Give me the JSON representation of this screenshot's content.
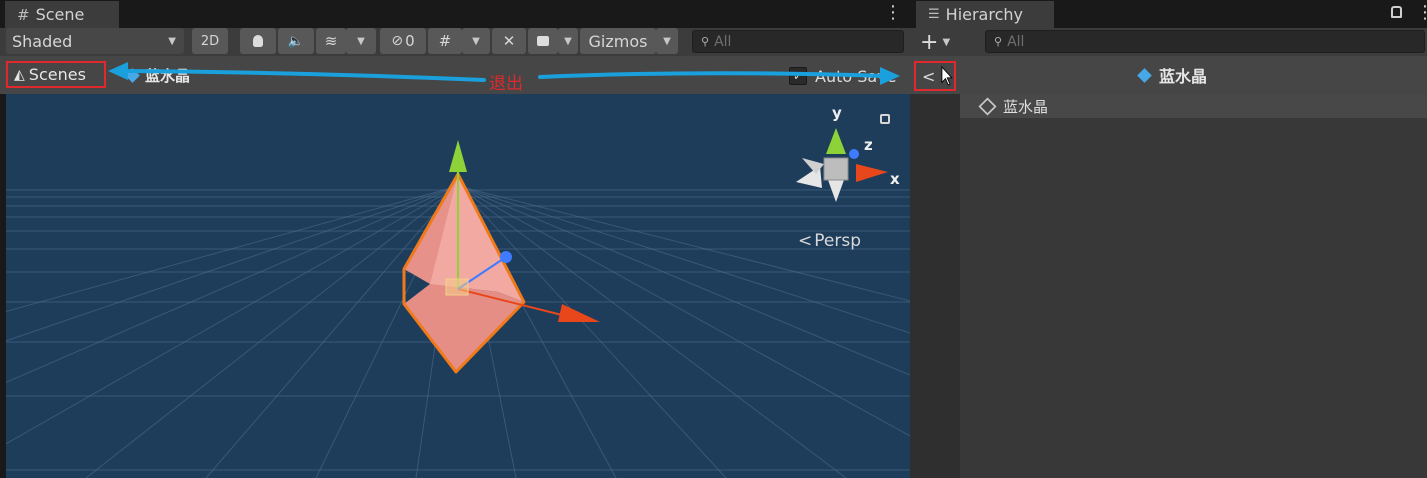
{
  "scene_panel": {
    "tab_label": "Scene",
    "shading_mode": "Shaded",
    "mode_2d_label": "2D",
    "hidden_count": "0",
    "gizmos_label": "Gizmos",
    "search_placeholder": "All",
    "breadcrumb_scenes": "Scenes",
    "breadcrumb_prefab": "蓝水晶",
    "auto_save_label": "Auto Save",
    "annotation_label": "退出",
    "projection_label": "Persp",
    "axis_labels": {
      "x": "x",
      "y": "y",
      "z": "z"
    }
  },
  "hierarchy_panel": {
    "tab_label": "Hierarchy",
    "search_placeholder": "All",
    "prefab_title": "蓝水晶",
    "items": [
      {
        "label": "蓝水晶"
      }
    ]
  },
  "colors": {
    "scene_background": "#1e3d5b",
    "annotation_red": "#e0282d",
    "arrow_blue": "#1aa0dc",
    "axis_x": "#e8471b",
    "axis_y": "#8ed23a",
    "axis_z": "#3f7bff",
    "selection_orange": "#f07a1a"
  }
}
